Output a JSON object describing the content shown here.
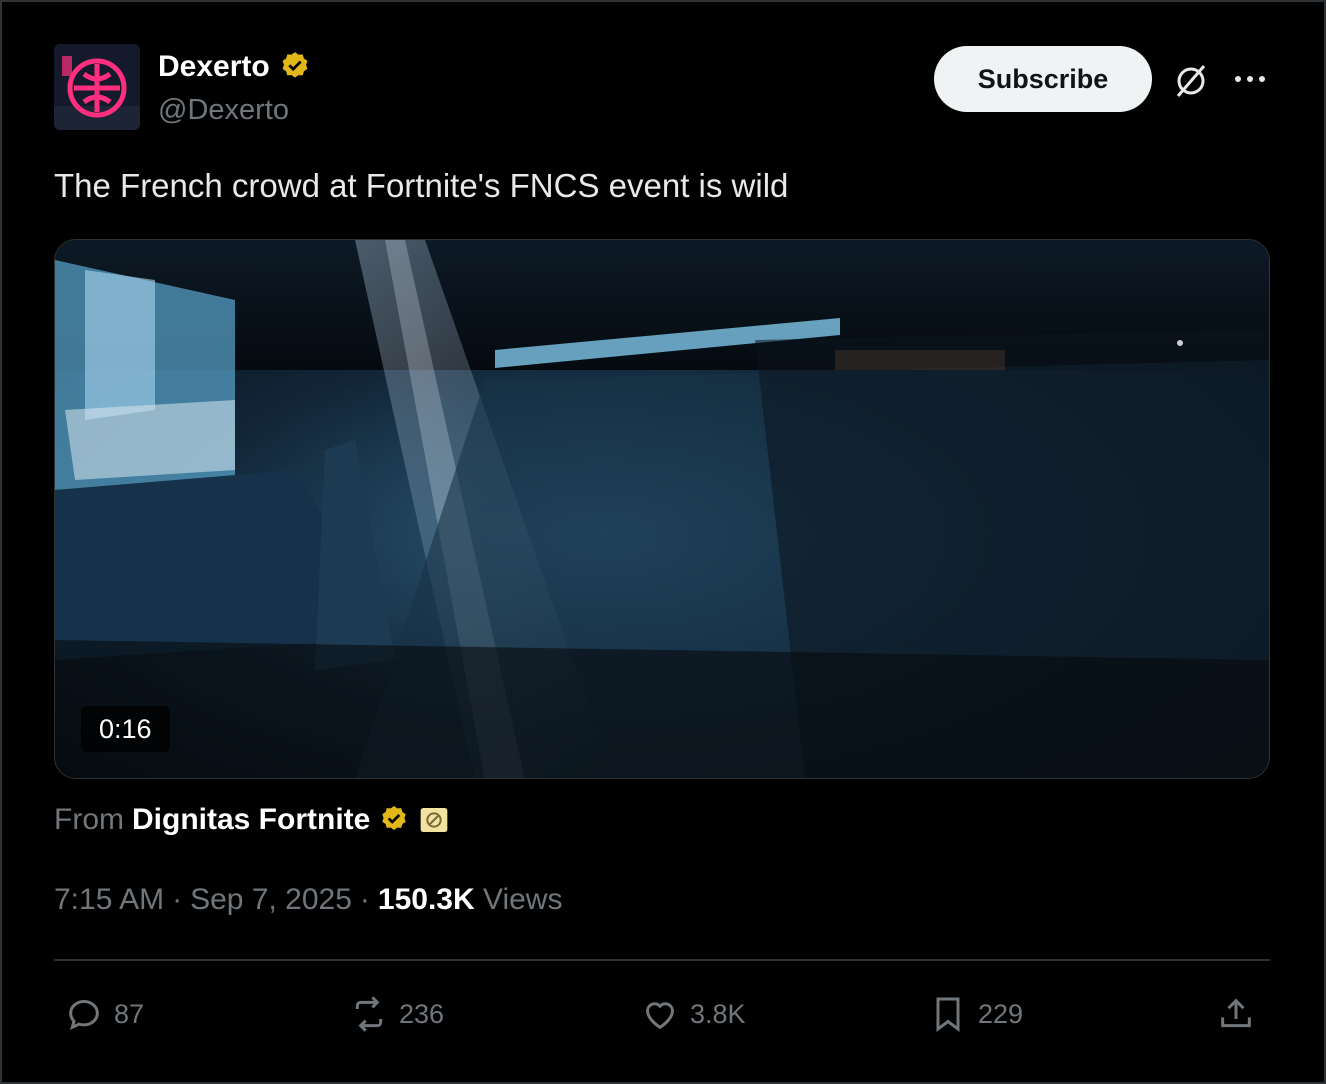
{
  "post": {
    "author_name": "Dexerto",
    "author_handle": "@Dexerto",
    "subscribe_label": "Subscribe",
    "text": "The French crowd at Fortnite's FNCS event is wild",
    "video_duration": "0:16",
    "source_prefix": "From",
    "source_name": "Dignitas Fortnite",
    "time": "7:15 AM",
    "date": "Sep 7, 2025",
    "views_count": "150.3K",
    "views_label": "Views",
    "separator": "·"
  },
  "actions": {
    "replies": "87",
    "reposts": "236",
    "likes": "3.8K",
    "bookmarks": "229"
  },
  "colors": {
    "background": "#000000",
    "text_primary": "#e7e9ea",
    "text_secondary": "#71767b",
    "verified_gold": "#e2b719",
    "avatar_pink": "#ff2e7e"
  },
  "icons": [
    "verified-icon",
    "grok-icon",
    "more-icon",
    "reply-icon",
    "repost-icon",
    "like-icon",
    "bookmark-icon",
    "share-icon",
    "affiliate-badge-icon"
  ]
}
